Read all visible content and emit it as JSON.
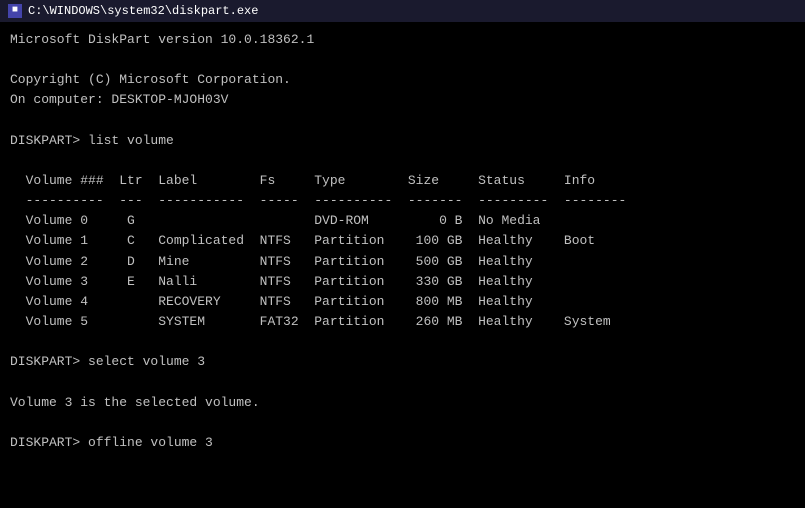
{
  "titlebar": {
    "icon": "■",
    "title": "C:\\WINDOWS\\system32\\diskpart.exe"
  },
  "terminal": {
    "line1": "Microsoft DiskPart version 10.0.18362.1",
    "line2": "",
    "line3": "Copyright (C) Microsoft Corporation.",
    "line4": "On computer: DESKTOP-MJOH03V",
    "line5": "",
    "line6": "DISKPART> list volume",
    "line7": "",
    "header1": "  Volume ###  Ltr  Label        Fs     Type        Size     Status     Info",
    "header2": "  ----------  ---  -----------  -----  ----------  -------  ---------  --------",
    "vol0": "  Volume 0     G                       DVD-ROM         0 B  No Media",
    "vol1": "  Volume 1     C   Complicated  NTFS   Partition    100 GB  Healthy    Boot",
    "vol2": "  Volume 2     D   Mine         NTFS   Partition    500 GB  Healthy",
    "vol3": "  Volume 3     E   Nalli        NTFS   Partition    330 GB  Healthy",
    "vol4": "  Volume 4         RECOVERY     NTFS   Partition    800 MB  Healthy",
    "vol5": "  Volume 5         SYSTEM       FAT32  Partition    260 MB  Healthy    System",
    "line_empty1": "",
    "cmd2": "DISKPART> select volume 3",
    "line_empty2": "",
    "result": "Volume 3 is the selected volume.",
    "line_empty3": "",
    "cmd3": "DISKPART> offline volume 3"
  }
}
